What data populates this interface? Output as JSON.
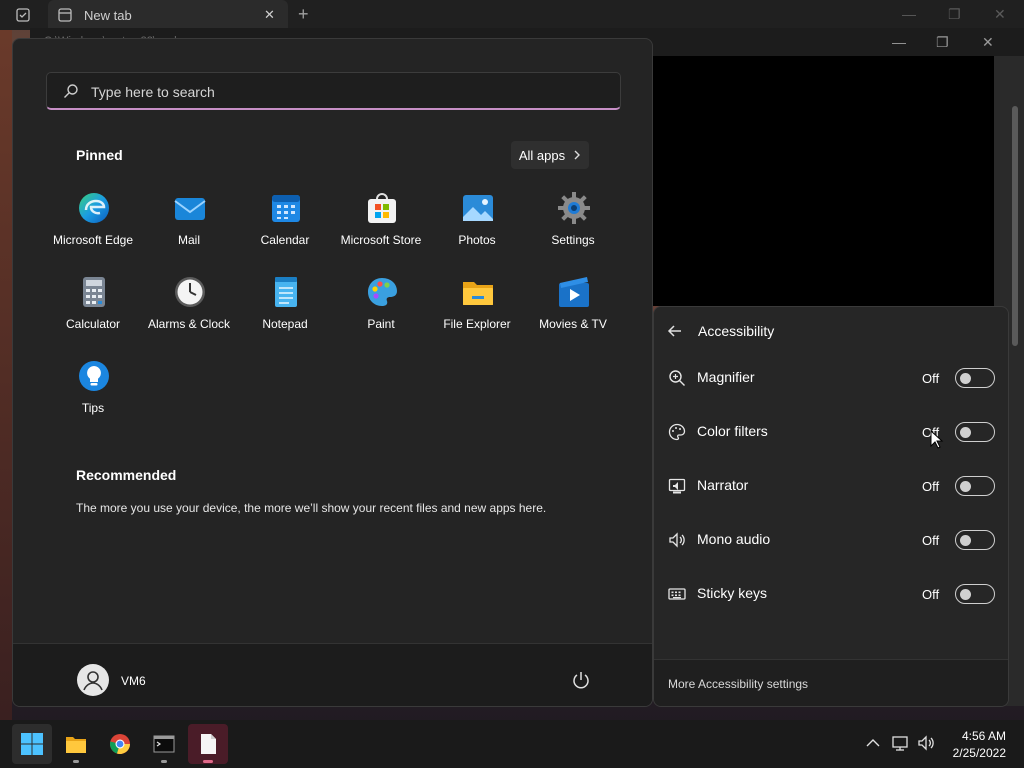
{
  "browser": {
    "tab_label": "New tab",
    "new_tab": "+",
    "minimize": "—",
    "restore": "❐",
    "close": "✕",
    "window2_title": "C:\\Windows\\system32\\cmd.exe"
  },
  "start_menu": {
    "search_placeholder": "Type here to search",
    "pinned_title": "Pinned",
    "all_apps_label": "All apps",
    "pinned_apps": [
      {
        "label": "Microsoft Edge",
        "icon": "edge-icon"
      },
      {
        "label": "Mail",
        "icon": "mail-icon"
      },
      {
        "label": "Calendar",
        "icon": "calendar-icon"
      },
      {
        "label": "Microsoft Store",
        "icon": "store-icon"
      },
      {
        "label": "Photos",
        "icon": "photos-icon"
      },
      {
        "label": "Settings",
        "icon": "settings-gear-icon"
      },
      {
        "label": "Calculator",
        "icon": "calculator-icon"
      },
      {
        "label": "Alarms & Clock",
        "icon": "clock-icon"
      },
      {
        "label": "Notepad",
        "icon": "notepad-icon"
      },
      {
        "label": "Paint",
        "icon": "paint-palette-icon"
      },
      {
        "label": "File Explorer",
        "icon": "folder-icon"
      },
      {
        "label": "Movies & TV",
        "icon": "movies-icon"
      },
      {
        "label": "Tips",
        "icon": "lightbulb-icon"
      }
    ],
    "recommended_title": "Recommended",
    "recommended_text": "The more you use your device, the more we’ll show your recent files and new apps here.",
    "user_name": "VM6"
  },
  "accessibility": {
    "title": "Accessibility",
    "items": [
      {
        "label": "Magnifier",
        "state": "Off",
        "icon": "magnifier-icon"
      },
      {
        "label": "Color filters",
        "state": "Off",
        "icon": "color-filters-icon"
      },
      {
        "label": "Narrator",
        "state": "Off",
        "icon": "narrator-icon"
      },
      {
        "label": "Mono audio",
        "state": "Off",
        "icon": "mono-audio-icon"
      },
      {
        "label": "Sticky keys",
        "state": "Off",
        "icon": "sticky-keys-icon"
      }
    ],
    "more_link": "More Accessibility settings"
  },
  "taskbar": {
    "time": "4:56 AM",
    "date": "2/25/2022"
  },
  "colors": {
    "accent_underline": "#c78fc6",
    "panel_bg": "#242424",
    "taskbar_bg": "#1a1a1a"
  }
}
